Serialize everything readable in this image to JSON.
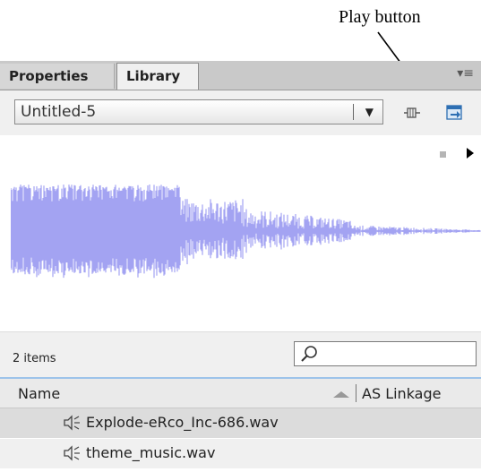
{
  "annotation": {
    "callout_text": "Play button"
  },
  "panel": {
    "tabs": [
      {
        "label": "Properties"
      },
      {
        "label": "Library"
      }
    ],
    "active_tab": "Library",
    "menu_glyph": "▾≡"
  },
  "toolbar": {
    "library_name": "Untitled-5",
    "dropdown_arrow": "▼"
  },
  "preview": {
    "type": "audio-waveform",
    "color": "#a3a3f2"
  },
  "list": {
    "item_count": "2 items",
    "search_placeholder": "",
    "columns": {
      "name": "Name",
      "linkage": "AS Linkage"
    },
    "items": [
      {
        "name": "Explode-eRco_Inc-686.wav",
        "icon": "speaker-icon"
      },
      {
        "name": "theme_music.wav",
        "icon": "speaker-icon"
      }
    ]
  },
  "colors": {
    "tab_bar": "#c9c9c9",
    "panel_bg": "#f0f0f0",
    "waveform": "#a3a3f2",
    "selected_row": "#dcdcdc"
  }
}
